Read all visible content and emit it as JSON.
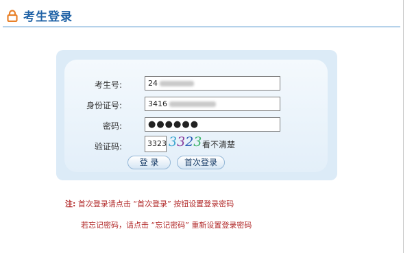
{
  "header": {
    "title": "考生登录",
    "icon": "lock-icon"
  },
  "form": {
    "exam_number_label": "考生号:",
    "exam_number_value": "24",
    "id_card_label": "身份证号:",
    "id_card_value": "3416",
    "password_label": "密码:",
    "password_value": "●●●●●●",
    "captcha_label": "验证码:",
    "captcha_value": "3323",
    "captcha_chars": [
      "3",
      "3",
      "2",
      "3"
    ],
    "captcha_colors": [
      "#3aa5d0",
      "#8a3c9c",
      "#2a5bb5",
      "#3bb46a"
    ],
    "captcha_refresh": "看不清楚",
    "login_button": "登 录",
    "first_login_button": "首次登录"
  },
  "notes": {
    "note1_prefix": "注:",
    "note1_text": "首次登录请点击 “首次登录” 按钮设置登录密码",
    "note2_text": "若忘记密码，请点击 “忘记密码” 重新设置登录密码"
  },
  "colors": {
    "title": "#1f62a6",
    "header_line": "#b5d2ea",
    "panel_outer": "#dcebf7",
    "note": "#b22a2a",
    "lock": "#e8812a"
  }
}
